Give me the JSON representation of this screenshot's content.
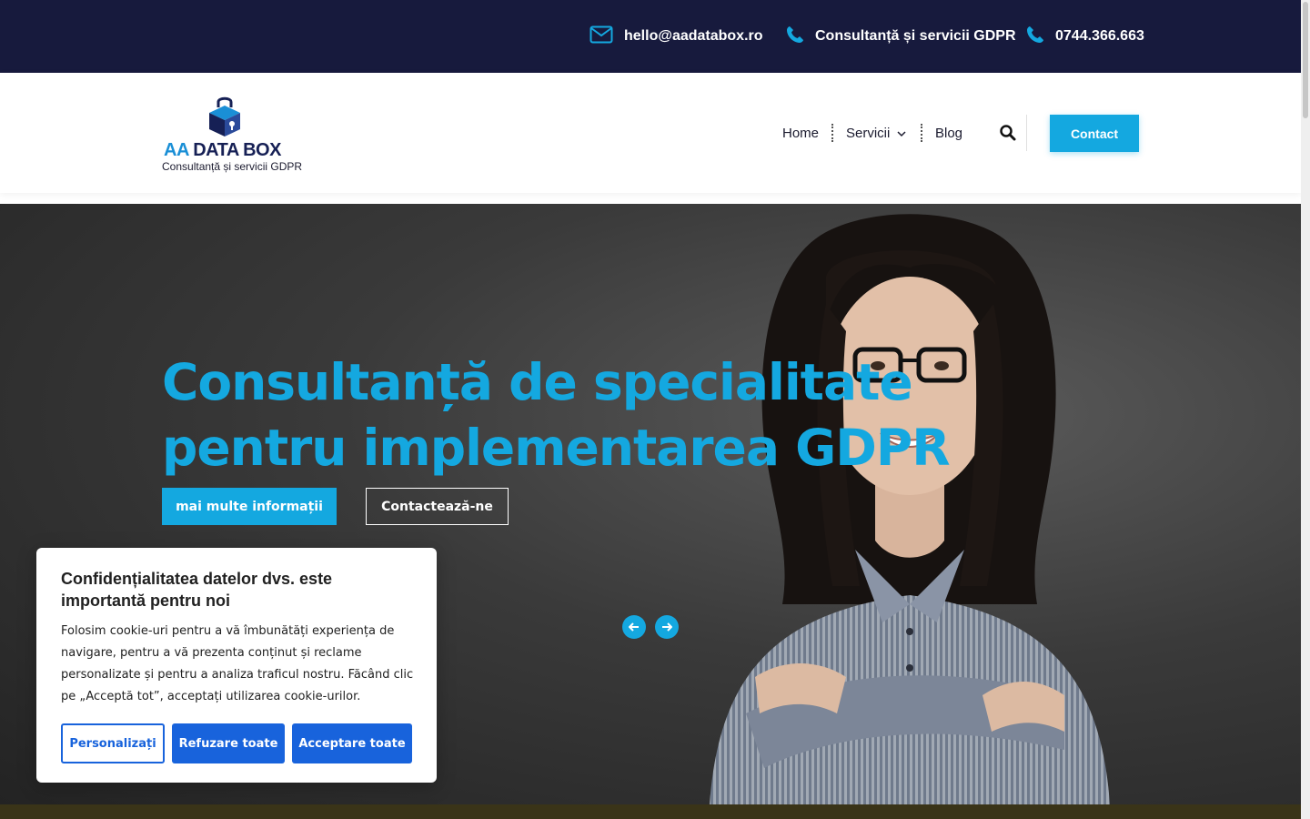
{
  "topbar": {
    "email": "hello@aadatabox.ro",
    "service": "Consultanță și servicii GDPR",
    "phone": "0744.366.663"
  },
  "header": {
    "logo_aa": "AA",
    "logo_name": "DATA BOX",
    "logo_tagline": "Consultanță și servicii GDPR",
    "nav": {
      "home": "Home",
      "servicii": "Servicii",
      "blog": "Blog"
    },
    "contact_button": "Contact"
  },
  "hero": {
    "title": "Consultanță de specialitate pentru implementarea GDPR",
    "primary_button": "mai multe informații",
    "secondary_button": "Contactează-ne"
  },
  "cookie_banner": {
    "title": "Confidențialitatea datelor dvs. este importantă pentru noi",
    "text": "Folosim cookie-uri pentru a vă îmbunătăți experiența de navigare, pentru a vă prezenta conținut și reclame personalizate și pentru a analiza traficul nostru. Făcând clic pe „Acceptă tot”, acceptați utilizarea cookie-urilor.",
    "customize_button": "Personalizați",
    "reject_button": "Refuzare toate",
    "accept_button": "Acceptare toate"
  },
  "icons": {
    "email": "envelope-icon",
    "phone": "phone-icon",
    "search": "search-icon",
    "chevron": "chevron-down-icon",
    "prev": "arrow-left-icon",
    "next": "arrow-right-icon"
  },
  "colors": {
    "topbar_bg": "#171a3d",
    "accent": "#14a8e0",
    "cookie_button": "#1863dc"
  }
}
